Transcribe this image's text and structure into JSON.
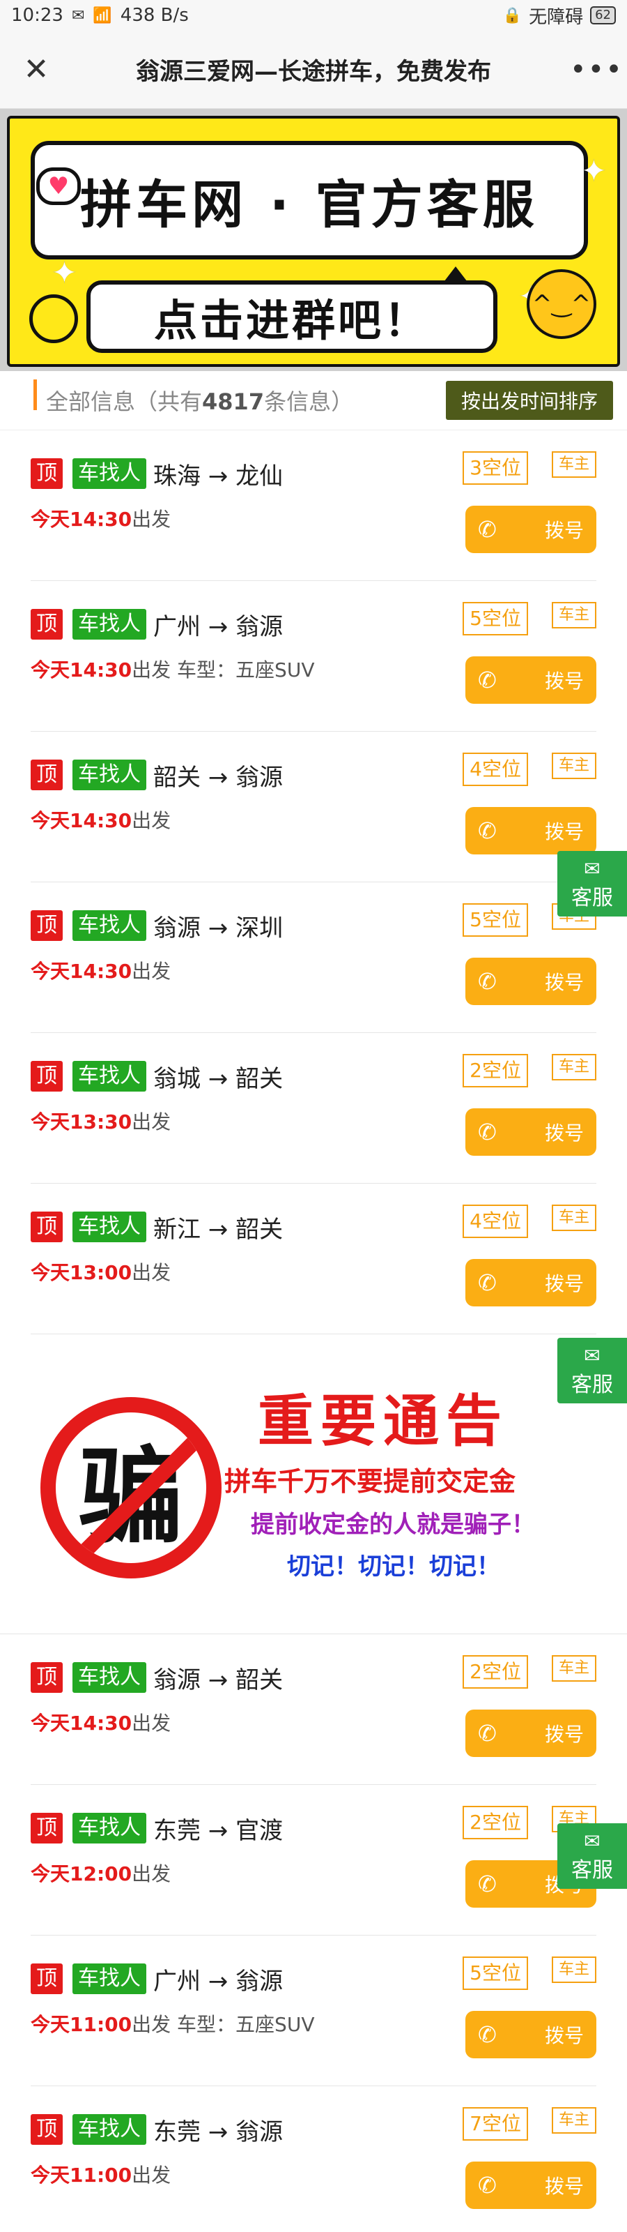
{
  "status": {
    "time": "10:23",
    "speed": "438 B/s",
    "accessibility": "无障碍",
    "battery": "62"
  },
  "header": {
    "title": "翁源三爱网—长途拼车，免费发布"
  },
  "banner": {
    "top_text": "拼车网 · 官方客服",
    "bottom_text": "点击进群吧！"
  },
  "info": {
    "prefix": "全部信息（共有",
    "count": "4817",
    "suffix": "条信息）",
    "sort_label": "按出发时间排序"
  },
  "labels": {
    "top": "顶",
    "dial": "拨号",
    "owner": "车主",
    "svc": "客服"
  },
  "listings": [
    {
      "type": "车找人",
      "route": "珠海 → 龙仙",
      "time": "今天14:30",
      "depart": "出发",
      "extra": "",
      "seats": "3空位"
    },
    {
      "type": "车找人",
      "route": "广州 → 翁源",
      "time": "今天14:30",
      "depart": "出发",
      "extra": " 车型：五座SUV",
      "seats": "5空位"
    },
    {
      "type": "车找人",
      "route": "韶关 → 翁源",
      "time": "今天14:30",
      "depart": "出发",
      "extra": "",
      "seats": "4空位"
    },
    {
      "type": "车找人",
      "route": "翁源 → 深圳",
      "time": "今天14:30",
      "depart": "出发",
      "extra": "",
      "seats": "5空位"
    },
    {
      "type": "车找人",
      "route": "翁城 → 韶关",
      "time": "今天13:30",
      "depart": "出发",
      "extra": "",
      "seats": "2空位"
    },
    {
      "type": "车找人",
      "route": "新江 → 韶关",
      "time": "今天13:00",
      "depart": "出发",
      "extra": "",
      "seats": "4空位"
    },
    {
      "type": "车找人",
      "route": "翁源 → 韶关",
      "time": "今天14:30",
      "depart": "出发",
      "extra": "",
      "seats": "2空位"
    },
    {
      "type": "车找人",
      "route": "东莞 → 官渡",
      "time": "今天12:00",
      "depart": "出发",
      "extra": "",
      "seats": "2空位"
    },
    {
      "type": "车找人",
      "route": "广州 → 翁源",
      "time": "今天11:00",
      "depart": "出发",
      "extra": " 车型：五座SUV",
      "seats": "5空位"
    },
    {
      "type": "车找人",
      "route": "东莞 → 翁源",
      "time": "今天11:00",
      "depart": "出发",
      "extra": "",
      "seats": "7空位"
    }
  ],
  "notice": {
    "icon_char": "骗",
    "title": "重要通告",
    "line1": "拼车千万不要提前交定金",
    "line2": "提前收定金的人就是骗子！",
    "line3": "切记！切记！切记！"
  }
}
